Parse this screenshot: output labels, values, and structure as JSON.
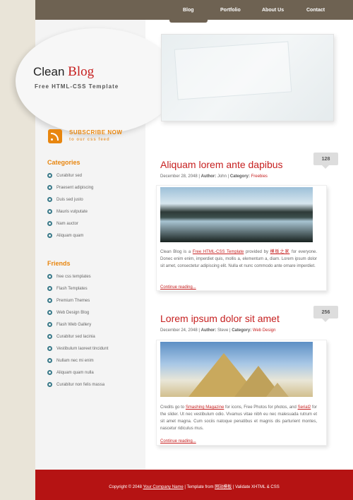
{
  "nav": {
    "items": [
      "Blog",
      "Portfolio",
      "About Us",
      "Contact"
    ]
  },
  "logo": {
    "clean": "Clean",
    "blog": "Blog",
    "tagline": "Free HTML-CSS Template"
  },
  "subscribe": {
    "title": "SUBSCRIBE NOW",
    "subtitle": "to our css feed",
    "icon": "rss-icon"
  },
  "categories": {
    "heading": "Categories",
    "items": [
      "Curabitur sed",
      "Praesent adipiscing",
      "Duis sed justo",
      "Mauris vulputate",
      "Nam auctor",
      "Aliquam quam"
    ]
  },
  "friends": {
    "heading": "Friends",
    "items": [
      "free css templates",
      "Flash Templates",
      "Premium Themes",
      "Web Design Blog",
      "Flash Web Gallery",
      "Curabitur sed lacinia",
      "Vestibulum laoreet tincidunt",
      "Nullam nec mi enim",
      "Aliquam quam nulla",
      "Curabitur non felis massa"
    ]
  },
  "posts": [
    {
      "title": "Aliquam lorem ante dapibus",
      "date": "December 28, 2048",
      "author_label": "Author:",
      "author": "John",
      "category_label": "Category:",
      "category": "Freebies",
      "comments": "128",
      "text_1": "Clean Blog is a ",
      "link_1": "Free HTML-CSS Template",
      "text_2": " provided by ",
      "link_2": "模板之家",
      "text_3": " for everyone. Donec enim enim, imperdiet quis, mollis a, elementum a, diam. Lorem ipsum dolor sit amet, consectetur adipiscing elit. Nulla et nunc commodo ante ornare imperdiet.",
      "read_more": "Continue reading..."
    },
    {
      "title": "Lorem ipsum dolor sit amet",
      "date": "December 24, 2048",
      "author_label": "Author:",
      "author": "Steve",
      "category_label": "Category:",
      "category": "Web Design",
      "comments": "256",
      "text_1": "Credits go to ",
      "link_1": "Smashing Magazine",
      "text_2": " for icons, Free Photos for photos, and ",
      "link_2": "Serial2",
      "text_3": " for the slider. Ut nec vestibulum odio. Vivamus vitae nibh eu nec malesuada rutrum et sit amet magna. Cum sociis natoque penatibus et magnis dis parturient montes, nascetur ridiculus mus.",
      "read_more": "Continue reading..."
    }
  ],
  "footer": {
    "copyright": "Copyright © 2048 ",
    "company": "Your Company Name",
    "template_from": " | Template from ",
    "template_site": "网站模板",
    "validate": " | Validate XHTML & CSS"
  }
}
